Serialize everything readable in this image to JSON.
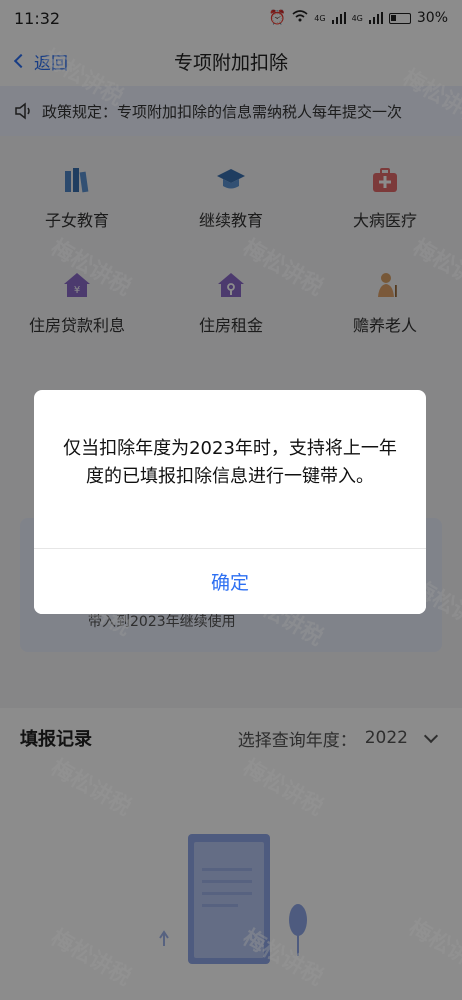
{
  "status_bar": {
    "time": "11:32",
    "battery_percent": "30%",
    "network_label": "4G"
  },
  "nav": {
    "back_label": "返回",
    "title": "专项附加扣除"
  },
  "notice": {
    "text": "政策规定：专项附加扣除的信息需纳税人每年提交一次"
  },
  "categories": [
    {
      "label": "子女教育",
      "icon": "books-icon"
    },
    {
      "label": "继续教育",
      "icon": "graduation-cap-icon"
    },
    {
      "label": "大病医疗",
      "icon": "medical-kit-icon"
    },
    {
      "label": "住房贷款利息",
      "icon": "house-loan-icon"
    },
    {
      "label": "住房租金",
      "icon": "house-key-icon"
    },
    {
      "label": "赡养老人",
      "icon": "elderly-icon"
    }
  ],
  "card": {
    "partial_text": "带入到2023年继续使用"
  },
  "records": {
    "title": "填报记录",
    "year_label": "选择查询年度：",
    "year_value": "2022"
  },
  "dialog": {
    "message": "仅当扣除年度为2023年时，支持将上一年度的已填报扣除信息进行一键带入。",
    "confirm_label": "确定"
  },
  "watermark": {
    "text": "梅松讲税"
  },
  "colors": {
    "accent": "#2d6ff2",
    "overlay": "rgba(0,0,0,0.45)"
  }
}
